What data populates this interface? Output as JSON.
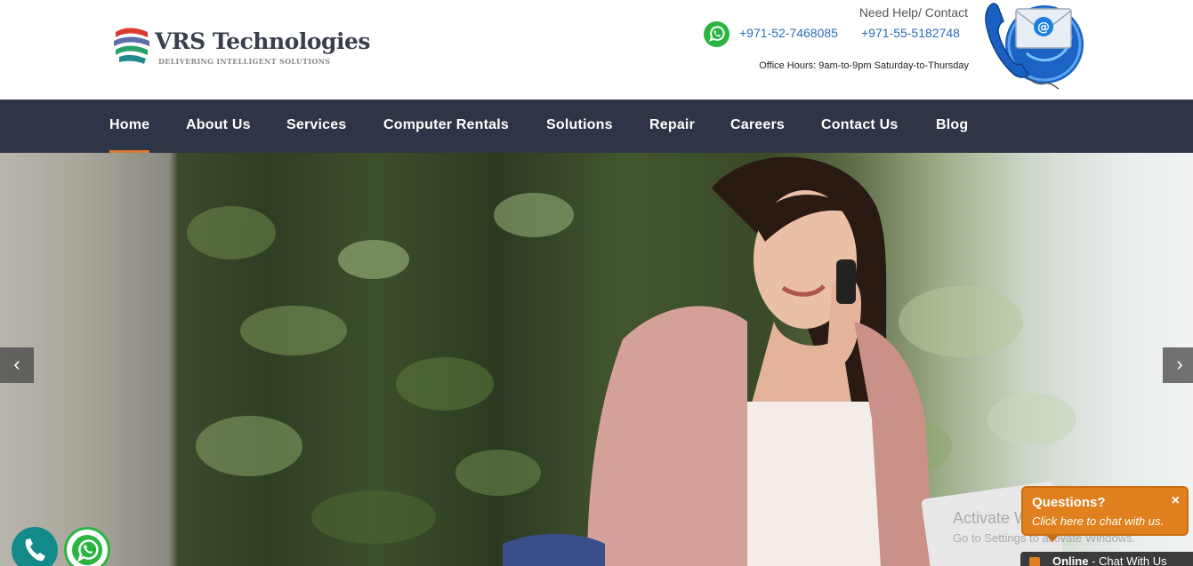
{
  "brand": {
    "name": "VRS Technologies",
    "tagline": "DELIVERING INTELLIGENT SOLUTIONS"
  },
  "contact": {
    "help": "Need Help/ Contact",
    "phone1": "+971-52-7468085",
    "phone2": "+971-55-5182748",
    "hours": "Office Hours: 9am-to-9pm Saturday-to-Thursday"
  },
  "nav": {
    "items": [
      {
        "label": "Home"
      },
      {
        "label": "About Us"
      },
      {
        "label": "Services"
      },
      {
        "label": "Computer Rentals"
      },
      {
        "label": "Solutions"
      },
      {
        "label": "Repair"
      },
      {
        "label": "Careers"
      },
      {
        "label": "Contact Us"
      },
      {
        "label": "Blog"
      }
    ],
    "active": "Home"
  },
  "hero": {
    "prev": "‹",
    "next": "›"
  },
  "watermark": {
    "title": "Activate Windows",
    "subtitle": "Go to Settings to activate Windows."
  },
  "chat": {
    "title": "Questions?",
    "subtitle": "Click here to chat with us.",
    "close": "×",
    "status": "Online",
    "status_text": " - Chat With Us"
  },
  "colors": {
    "nav_bg": "#2f3547",
    "accent": "#d9772e",
    "link": "#2a6fb5",
    "chat": "#e0801e"
  },
  "icons": {
    "logo": "brand-swoosh-icon",
    "whatsapp": "whatsapp-icon",
    "contact_graphic": "phone-envelope-icon",
    "float_phone": "phone-icon",
    "float_whatsapp": "whatsapp-icon"
  }
}
